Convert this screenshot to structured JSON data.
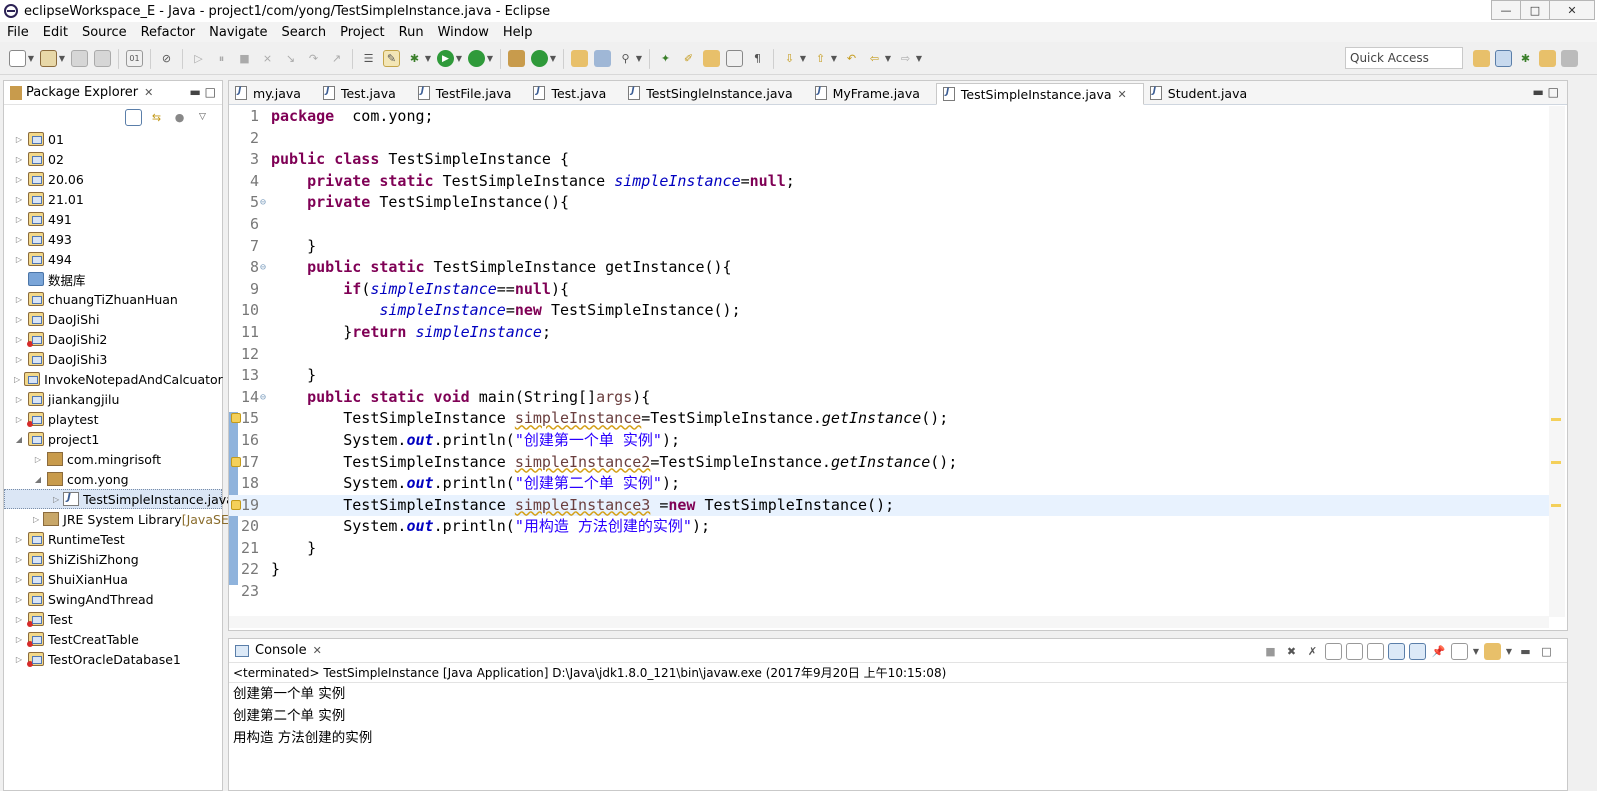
{
  "window": {
    "title": "eclipseWorkspace_E - Java - project1/com/yong/TestSimpleInstance.java - Eclipse",
    "minimize": "—",
    "maximize": "□",
    "close": "✕"
  },
  "menu": [
    "File",
    "Edit",
    "Source",
    "Refactor",
    "Navigate",
    "Search",
    "Project",
    "Run",
    "Window",
    "Help"
  ],
  "toolbar": {
    "quick_access": "Quick Access"
  },
  "package_explorer": {
    "tab_label": "Package Explorer",
    "items": [
      {
        "label": "01",
        "icon": "project",
        "level": 0,
        "expanded": false
      },
      {
        "label": "02",
        "icon": "project",
        "level": 0,
        "expanded": false
      },
      {
        "label": "20.06",
        "icon": "project",
        "level": 0,
        "expanded": false
      },
      {
        "label": "21.01",
        "icon": "project",
        "level": 0,
        "expanded": false
      },
      {
        "label": "491",
        "icon": "project",
        "level": 0,
        "expanded": false
      },
      {
        "label": "493",
        "icon": "project",
        "level": 0,
        "expanded": false
      },
      {
        "label": "494",
        "icon": "project",
        "level": 0,
        "expanded": false
      },
      {
        "label": "数据库",
        "icon": "folder",
        "level": 0,
        "expanded": null
      },
      {
        "label": "chuangTiZhuanHuan",
        "icon": "project",
        "level": 0,
        "expanded": false
      },
      {
        "label": "DaoJiShi",
        "icon": "project",
        "level": 0,
        "expanded": false
      },
      {
        "label": "DaoJiShi2",
        "icon": "project-error",
        "level": 0,
        "expanded": false
      },
      {
        "label": "DaoJiShi3",
        "icon": "project",
        "level": 0,
        "expanded": false
      },
      {
        "label": "InvokeNotepadAndCalcuator",
        "icon": "project",
        "level": 0,
        "expanded": false
      },
      {
        "label": "jiankangjilu",
        "icon": "project",
        "level": 0,
        "expanded": false
      },
      {
        "label": "playtest",
        "icon": "project-error",
        "level": 0,
        "expanded": false
      },
      {
        "label": "project1",
        "icon": "project",
        "level": 0,
        "expanded": true
      },
      {
        "label": "com.mingrisoft",
        "icon": "package",
        "level": 1,
        "expanded": false
      },
      {
        "label": "com.yong",
        "icon": "package",
        "level": 1,
        "expanded": true
      },
      {
        "label": "TestSimpleInstance.java",
        "icon": "java",
        "level": 2,
        "expanded": false,
        "selected": true
      },
      {
        "label": "JRE System Library",
        "suffix": "[JavaSE",
        "icon": "library",
        "level": 1,
        "expanded": false
      },
      {
        "label": "RuntimeTest",
        "icon": "project",
        "level": 0,
        "expanded": false
      },
      {
        "label": "ShiZiShiZhong",
        "icon": "project",
        "level": 0,
        "expanded": false
      },
      {
        "label": "ShuiXianHua",
        "icon": "project",
        "level": 0,
        "expanded": false
      },
      {
        "label": "SwingAndThread",
        "icon": "project",
        "level": 0,
        "expanded": false
      },
      {
        "label": "Test",
        "icon": "project-error",
        "level": 0,
        "expanded": false
      },
      {
        "label": "TestCreatTable",
        "icon": "project-error",
        "level": 0,
        "expanded": false
      },
      {
        "label": "TestOracleDatabase1",
        "icon": "project-error",
        "level": 0,
        "expanded": false
      }
    ]
  },
  "editor": {
    "tabs": [
      {
        "label": "my.java",
        "active": false
      },
      {
        "label": "Test.java",
        "active": false
      },
      {
        "label": "TestFile.java",
        "active": false
      },
      {
        "label": "Test.java",
        "active": false
      },
      {
        "label": "TestSingleInstance.java",
        "active": false
      },
      {
        "label": "MyFrame.java",
        "active": false
      },
      {
        "label": "TestSimpleInstance.java",
        "active": true
      },
      {
        "label": "Student.java",
        "active": false
      }
    ],
    "highlight_line": 19,
    "lines": [
      {
        "n": "1",
        "fold": "",
        "warn": false,
        "tokens": [
          [
            "kw",
            "package"
          ],
          [
            "",
            "  com.yong;"
          ]
        ]
      },
      {
        "n": "2",
        "fold": "",
        "warn": false,
        "tokens": []
      },
      {
        "n": "3",
        "fold": "",
        "warn": false,
        "tokens": [
          [
            "kw",
            "public class"
          ],
          [
            "",
            " TestSimpleInstance {"
          ]
        ]
      },
      {
        "n": "4",
        "fold": "",
        "warn": false,
        "tokens": [
          [
            "",
            "    "
          ],
          [
            "kw",
            "private static"
          ],
          [
            "",
            " TestSimpleInstance "
          ],
          [
            "field",
            "simpleInstance"
          ],
          [
            "",
            "="
          ],
          [
            "kw",
            "null"
          ],
          [
            "",
            ";"
          ]
        ]
      },
      {
        "n": "5",
        "fold": "⊖",
        "warn": false,
        "tokens": [
          [
            "",
            "    "
          ],
          [
            "kw",
            "private"
          ],
          [
            "",
            " TestSimpleInstance(){"
          ]
        ]
      },
      {
        "n": "6",
        "fold": "",
        "warn": false,
        "tokens": []
      },
      {
        "n": "7",
        "fold": "",
        "warn": false,
        "tokens": [
          [
            "",
            "    }"
          ]
        ]
      },
      {
        "n": "8",
        "fold": "⊖",
        "warn": false,
        "tokens": [
          [
            "",
            "    "
          ],
          [
            "kw",
            "public static"
          ],
          [
            "",
            " TestSimpleInstance getInstance(){"
          ]
        ]
      },
      {
        "n": "9",
        "fold": "",
        "warn": false,
        "tokens": [
          [
            "",
            "        "
          ],
          [
            "kw",
            "if"
          ],
          [
            "",
            "("
          ],
          [
            "field",
            "simpleInstance"
          ],
          [
            "",
            "=="
          ],
          [
            "kw",
            "null"
          ],
          [
            "",
            "){"
          ]
        ]
      },
      {
        "n": "10",
        "fold": "",
        "warn": false,
        "tokens": [
          [
            "",
            "            "
          ],
          [
            "field",
            "simpleInstance"
          ],
          [
            "",
            "="
          ],
          [
            "kw",
            "new"
          ],
          [
            "",
            " TestSimpleInstance();"
          ]
        ]
      },
      {
        "n": "11",
        "fold": "",
        "warn": false,
        "tokens": [
          [
            "",
            "        }"
          ],
          [
            "kw",
            "return"
          ],
          [
            "",
            " "
          ],
          [
            "field",
            "simpleInstance"
          ],
          [
            "",
            ";"
          ]
        ]
      },
      {
        "n": "12",
        "fold": "",
        "warn": false,
        "tokens": []
      },
      {
        "n": "13",
        "fold": "",
        "warn": false,
        "tokens": [
          [
            "",
            "    }"
          ]
        ]
      },
      {
        "n": "14",
        "fold": "⊖",
        "warn": false,
        "tokens": [
          [
            "",
            "    "
          ],
          [
            "kw",
            "public static void"
          ],
          [
            "",
            " main(String[]"
          ],
          [
            "param",
            "args"
          ],
          [
            "",
            "){"
          ]
        ]
      },
      {
        "n": "15",
        "fold": "",
        "warn": true,
        "tokens": [
          [
            "",
            "        TestSimpleInstance "
          ],
          [
            "local",
            "simpleInstance"
          ],
          [
            "",
            "=TestSimpleInstance."
          ],
          [
            "sm",
            "getInstance"
          ],
          [
            "",
            "();"
          ]
        ]
      },
      {
        "n": "16",
        "fold": "",
        "warn": false,
        "tokens": [
          [
            "",
            "        System."
          ],
          [
            "static",
            "out"
          ],
          [
            "",
            ".println("
          ],
          [
            "str",
            "\"创建第一个单 实例\""
          ],
          [
            "",
            ");"
          ]
        ]
      },
      {
        "n": "17",
        "fold": "",
        "warn": true,
        "tokens": [
          [
            "",
            "        TestSimpleInstance "
          ],
          [
            "local",
            "simpleInstance2"
          ],
          [
            "",
            "=TestSimpleInstance."
          ],
          [
            "sm",
            "getInstance"
          ],
          [
            "",
            "();"
          ]
        ]
      },
      {
        "n": "18",
        "fold": "",
        "warn": false,
        "tokens": [
          [
            "",
            "        System."
          ],
          [
            "static",
            "out"
          ],
          [
            "",
            ".println("
          ],
          [
            "str",
            "\"创建第二个单 实例\""
          ],
          [
            "",
            ");"
          ]
        ]
      },
      {
        "n": "19",
        "fold": "",
        "warn": true,
        "tokens": [
          [
            "",
            "        TestSimpleInstance "
          ],
          [
            "local",
            "simpleInstance3"
          ],
          [
            "",
            " ="
          ],
          [
            "kw",
            "new"
          ],
          [
            "",
            " TestSimpleInstance();"
          ]
        ]
      },
      {
        "n": "20",
        "fold": "",
        "warn": false,
        "tokens": [
          [
            "",
            "        System."
          ],
          [
            "static",
            "out"
          ],
          [
            "",
            ".println("
          ],
          [
            "str",
            "\"用构造 方法创建的实例\""
          ],
          [
            "",
            ");"
          ]
        ]
      },
      {
        "n": "21",
        "fold": "",
        "warn": false,
        "tokens": [
          [
            "",
            "    }"
          ]
        ]
      },
      {
        "n": "22",
        "fold": "",
        "warn": false,
        "tokens": [
          [
            "",
            "}"
          ]
        ]
      },
      {
        "n": "23",
        "fold": "",
        "warn": false,
        "tokens": []
      }
    ]
  },
  "console": {
    "tab_label": "Console",
    "status": "<terminated> TestSimpleInstance [Java Application] D:\\Java\\jdk1.8.0_121\\bin\\javaw.exe (2017年9月20日 上午10:15:08)",
    "output": [
      "创建第一个单 实例",
      "创建第二个单 实例",
      "用构造 方法创建的实例"
    ]
  },
  "colors": {
    "keyword": "#7f0055",
    "field": "#0000c0",
    "string": "#2a00ff",
    "highlight_line": "#e8f2fe",
    "selection": "#dbe6f5"
  }
}
